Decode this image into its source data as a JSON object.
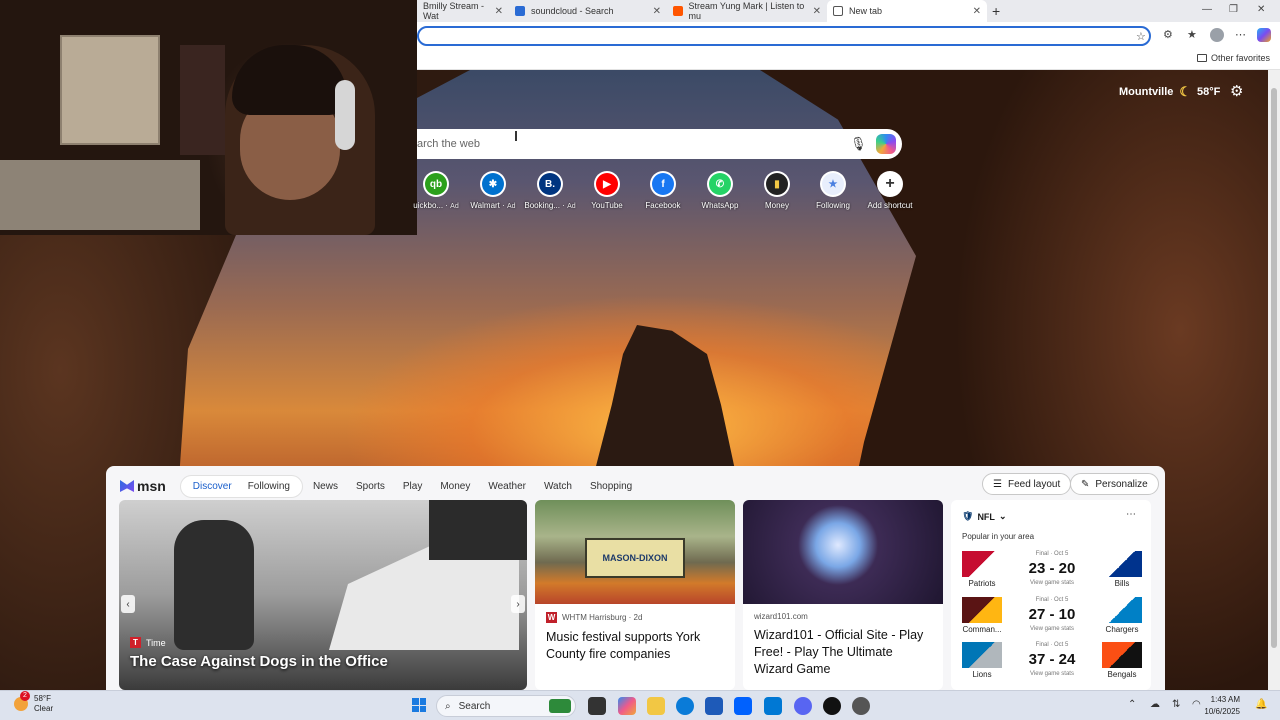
{
  "browser": {
    "tabs": [
      {
        "label": "Bmilly Stream - Wat",
        "icon_color": "#9146ff"
      },
      {
        "label": "soundcloud - Search",
        "icon_color": "#2a6bd4"
      },
      {
        "label": "Stream Yung Mark | Listen to mu",
        "icon_color": "#ff5500"
      },
      {
        "label": "New tab",
        "icon_color": "#555555"
      }
    ],
    "other_favorites": "Other favorites"
  },
  "weather": {
    "location": "Mountville",
    "temp": "58°F"
  },
  "search": {
    "placeholder": "arch the web"
  },
  "shortcuts": [
    {
      "label": "uickbo...",
      "ad": "Ad",
      "icon_text": "qb",
      "color": "#2ca01c"
    },
    {
      "label": "Walmart",
      "ad": "Ad",
      "icon_text": "✱",
      "color": "#0071ce"
    },
    {
      "label": "Booking...",
      "ad": "Ad",
      "icon_text": "B.",
      "color": "#003580"
    },
    {
      "label": "YouTube",
      "ad": "",
      "icon_text": "▶",
      "color": "#ff0000"
    },
    {
      "label": "Facebook",
      "ad": "",
      "icon_text": "f",
      "color": "#1877f2"
    },
    {
      "label": "WhatsApp",
      "ad": "",
      "icon_text": "✆",
      "color": "#25d366"
    },
    {
      "label": "Money",
      "ad": "",
      "icon_text": "▮",
      "color": "#222222"
    },
    {
      "label": "Following",
      "ad": "",
      "icon_text": "★",
      "color": "#4a7fe0"
    },
    {
      "label": "Add shortcut",
      "ad": "",
      "icon_text": "+",
      "color": "#ffffff"
    }
  ],
  "feed": {
    "logo": "msn",
    "tabs": [
      "Discover",
      "Following"
    ],
    "nav": [
      "News",
      "Sports",
      "Play",
      "Money",
      "Weather",
      "Watch",
      "Shopping"
    ],
    "feed_layout": "Feed layout",
    "personalize": "Personalize",
    "hero": {
      "source": "Time",
      "title": "The Case Against Dogs in the Office"
    },
    "card1": {
      "source": "WHTM Harrisburg · 2d",
      "title": "Music festival supports York County fire companies",
      "image_text": "MASON-DIXON"
    },
    "card2": {
      "source": "wizard101.com",
      "title": "Wizard101 - Official Site - Play Free! - Play The Ultimate Wizard Game"
    },
    "nfl": {
      "title": "NFL",
      "subtitle": "Popular in your area",
      "games": [
        {
          "status": "Final · Oct 5",
          "home": "Patriots",
          "away": "Bills",
          "score": "23 - 20",
          "stats": "View game stats",
          "home_color": "#c60c30",
          "away_color": "#00338d"
        },
        {
          "status": "Final · Oct 5",
          "home": "Comman...",
          "away": "Chargers",
          "score": "27 - 10",
          "stats": "View game stats",
          "home_color": "#5a1414",
          "away_color": "#0080c6"
        },
        {
          "status": "Final · Oct 5",
          "home": "Lions",
          "away": "Bengals",
          "score": "37 - 24",
          "stats": "View game stats",
          "home_color": "#0076b6",
          "away_color": "#fb4f14"
        }
      ]
    }
  },
  "taskbar": {
    "weather_temp": "58°F",
    "weather_desc": "Clear",
    "notification_count": "2",
    "search": "Search",
    "time": "1:43 AM",
    "date": "10/6/2025"
  }
}
